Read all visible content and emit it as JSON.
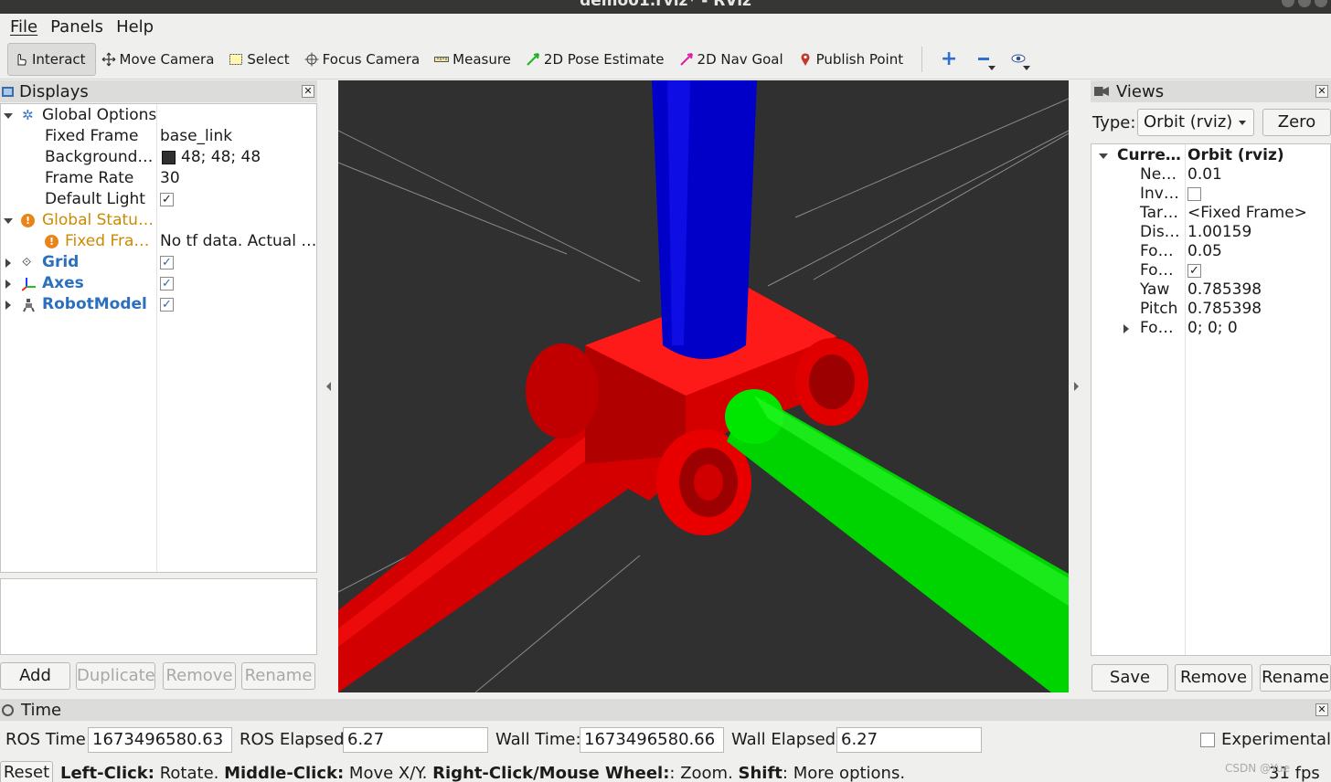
{
  "window": {
    "title": "demo01.rviz* - RViz"
  },
  "menu": {
    "file": "File",
    "panels": "Panels",
    "help": "Help"
  },
  "toolbar": {
    "tools": [
      "Interact",
      "Move Camera",
      "Select",
      "Focus Camera",
      "Measure",
      "2D Pose Estimate",
      "2D Nav Goal",
      "Publish Point"
    ]
  },
  "displays": {
    "title": "Displays",
    "global_options": "Global Options",
    "fixed_frame_label": "Fixed Frame",
    "fixed_frame_value": "base_link",
    "background_label": "Background…",
    "background_value": "48; 48; 48",
    "frame_rate_label": "Frame Rate",
    "frame_rate_value": "30",
    "default_light_label": "Default Light",
    "global_status": "Global Statu…",
    "fixed_frame_status_label": "Fixed Fra…",
    "fixed_frame_status_value": "No tf data.  Actual …",
    "grid": "Grid",
    "axes": "Axes",
    "robot_model": "RobotModel",
    "add": "Add",
    "duplicate": "Duplicate",
    "remove": "Remove",
    "rename": "Rename"
  },
  "views": {
    "title": "Views",
    "type_label": "Type:",
    "type_value": "Orbit (rviz)",
    "zero": "Zero",
    "current_label": "Curre…",
    "current_value": "Orbit (rviz)",
    "rows": [
      {
        "label": "Ne…",
        "value": "0.01"
      },
      {
        "label": "Inv…",
        "value": ""
      },
      {
        "label": "Tar…",
        "value": "<Fixed Frame>"
      },
      {
        "label": "Dis…",
        "value": "1.00159"
      },
      {
        "label": "Fo…",
        "value": "0.05"
      },
      {
        "label": "Fo…",
        "value": ""
      },
      {
        "label": "Yaw",
        "value": "0.785398"
      },
      {
        "label": "Pitch",
        "value": "0.785398"
      },
      {
        "label": "Fo…",
        "value": "0; 0; 0"
      }
    ],
    "save": "Save",
    "remove": "Remove",
    "rename": "Rename"
  },
  "time": {
    "title": "Time",
    "ros_time_label": "ROS Time:",
    "ros_time_value": "1673496580.63",
    "ros_elapsed_label": "ROS Elapsed:",
    "ros_elapsed_value": "6.27",
    "wall_time_label": "Wall Time:",
    "wall_time_value": "1673496580.66",
    "wall_elapsed_label": "Wall Elapsed:",
    "wall_elapsed_value": "6.27",
    "experimental": "Experimental"
  },
  "status": {
    "reset": "Reset",
    "h1": "Left-Click:",
    "t1": " Rotate. ",
    "h2": "Middle-Click:",
    "t2": " Move X/Y. ",
    "h3": "Right-Click/Mouse Wheel:",
    "t3": ": Zoom. ",
    "h4": "Shift",
    "t4": ": More options.",
    "fps": "31 fps",
    "watermark": "CSDN @Yue"
  },
  "colors": {
    "background": "#303030",
    "x_axis": "#ff0000",
    "y_axis": "#00ff00",
    "z_axis": "#0000ff"
  }
}
